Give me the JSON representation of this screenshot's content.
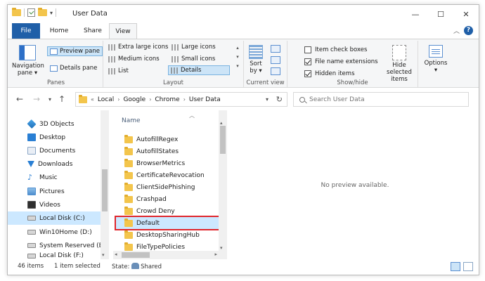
{
  "window": {
    "title": "User Data",
    "minimize": "—",
    "maximize": "☐",
    "close": "✕"
  },
  "ribbon_tabs": {
    "file": "File",
    "home": "Home",
    "share": "Share",
    "view": "View"
  },
  "ribbon": {
    "panes": {
      "label": "Panes",
      "navigation_pane": "Navigation pane",
      "preview_pane": "Preview pane",
      "details_pane": "Details pane"
    },
    "layout": {
      "label": "Layout",
      "extra_large_icons": "Extra large icons",
      "large_icons": "Large icons",
      "medium_icons": "Medium icons",
      "small_icons": "Small icons",
      "list": "List",
      "details": "Details"
    },
    "current_view": {
      "label": "Current view",
      "sort_by": "Sort by"
    },
    "show_hide": {
      "label": "Show/hide",
      "item_check_boxes": "Item check boxes",
      "file_name_extensions": "File name extensions",
      "hidden_items": "Hidden items",
      "hide_selected_items": "Hide selected items"
    },
    "options": {
      "label": "Options"
    }
  },
  "address": {
    "breadcrumbs": [
      "Local",
      "Google",
      "Chrome",
      "User Data"
    ],
    "overflow": "«",
    "search_placeholder": "Search User Data"
  },
  "nav_pane": {
    "items": [
      {
        "label": "3D Objects",
        "icon": "cube-icon"
      },
      {
        "label": "Desktop",
        "icon": "desktop-icon"
      },
      {
        "label": "Documents",
        "icon": "documents-icon"
      },
      {
        "label": "Downloads",
        "icon": "downloads-icon"
      },
      {
        "label": "Music",
        "icon": "music-icon"
      },
      {
        "label": "Pictures",
        "icon": "pictures-icon"
      },
      {
        "label": "Videos",
        "icon": "videos-icon"
      },
      {
        "label": "Local Disk (C:)",
        "icon": "disk-icon",
        "selected": true
      },
      {
        "label": "Win10Home (D:)",
        "icon": "disk-icon"
      },
      {
        "label": "System Reserved (E:)",
        "icon": "disk-icon"
      },
      {
        "label": "Local Disk (F:)",
        "icon": "disk-icon"
      }
    ]
  },
  "file_list": {
    "column_name": "Name",
    "items": [
      {
        "name": "AutofillRegex"
      },
      {
        "name": "AutofillStates"
      },
      {
        "name": "BrowserMetrics"
      },
      {
        "name": "CertificateRevocation"
      },
      {
        "name": "ClientSidePhishing"
      },
      {
        "name": "Crashpad"
      },
      {
        "name": "Crowd Deny"
      },
      {
        "name": "Default",
        "selected": true
      },
      {
        "name": "DesktopSharingHub"
      },
      {
        "name": "FileTypePolicies"
      }
    ]
  },
  "preview": {
    "message": "No preview available."
  },
  "status": {
    "item_count": "46 items",
    "selected": "1 item selected",
    "state_label": "State:",
    "state_value": "Shared"
  }
}
